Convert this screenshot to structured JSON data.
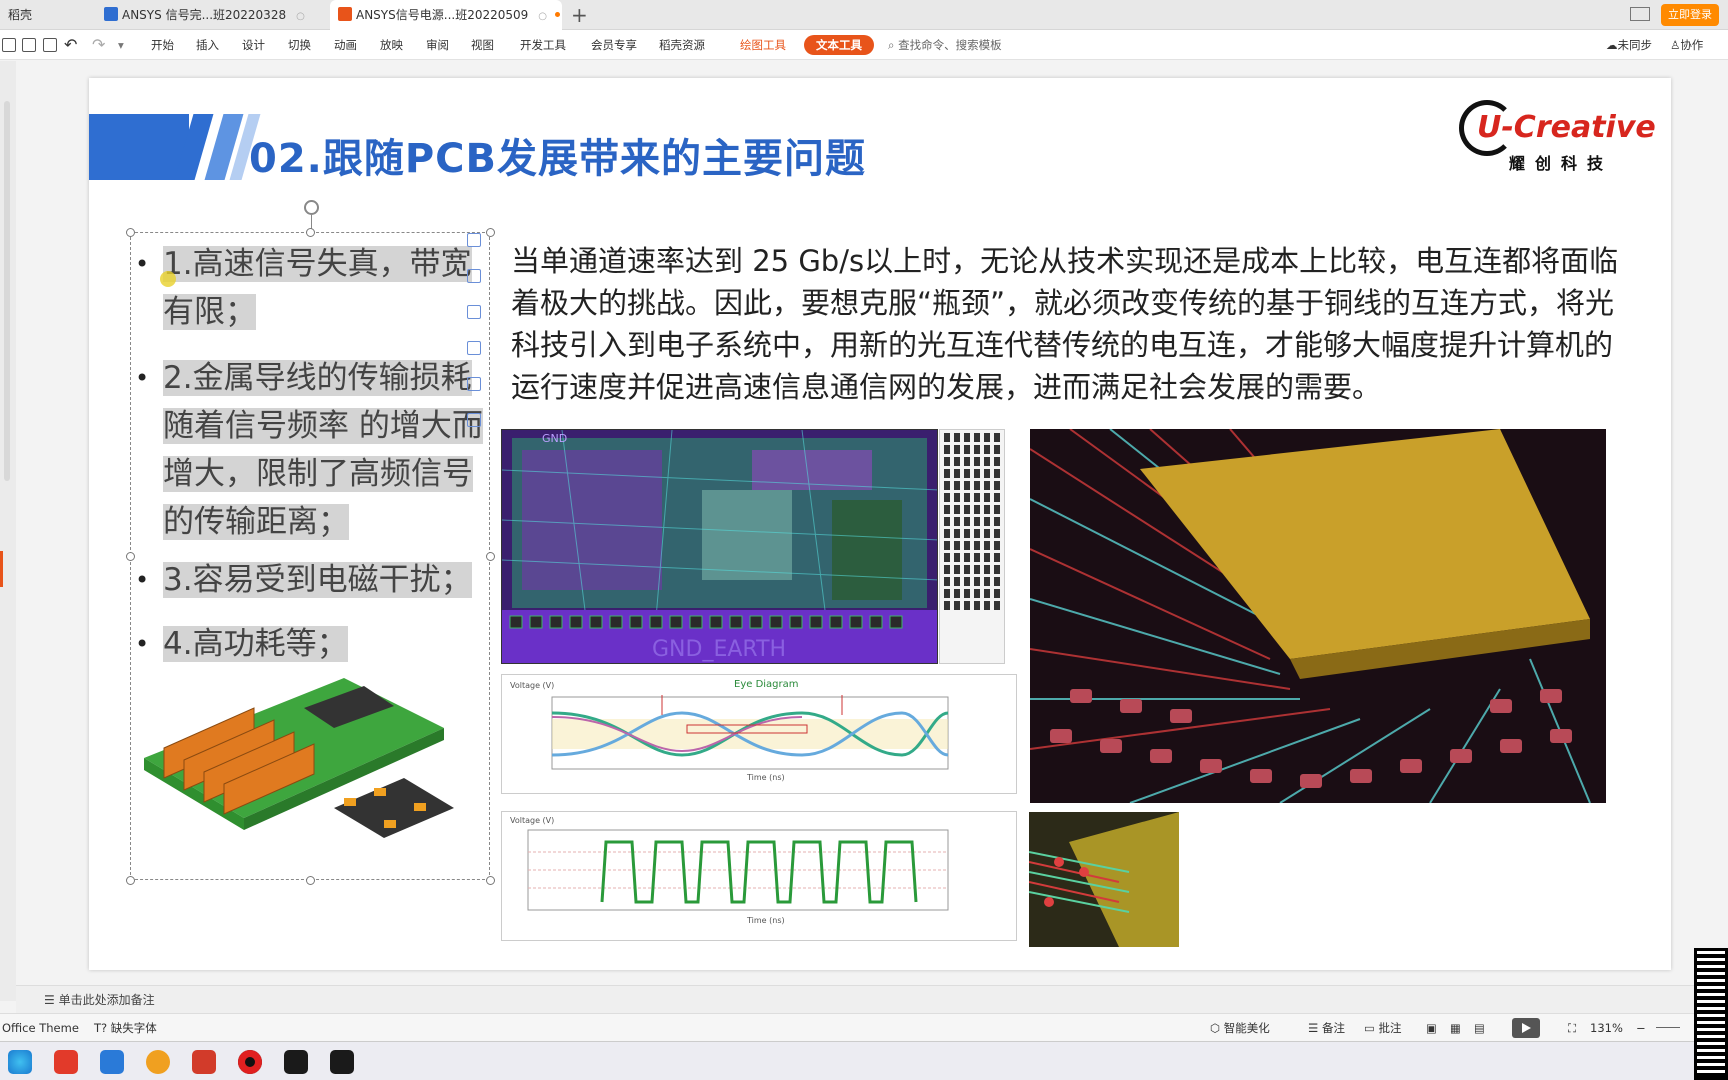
{
  "tabs": {
    "home": "稻壳",
    "doc1": "ANSYS 信号完...班20220328",
    "doc2": "ANSYS信号电源...班20220509",
    "new_tab": "+",
    "login": "立即登录"
  },
  "menu": {
    "items": [
      "开始",
      "插入",
      "设计",
      "切换",
      "动画",
      "放映",
      "审阅",
      "视图",
      "开发工具",
      "会员专享",
      "稻壳资源"
    ],
    "draw_tools": "绘图工具",
    "text_tools": "文本工具",
    "search": "查找命令、搜索模板",
    "unsynced": "未同步",
    "collab": "协作"
  },
  "slide": {
    "title": "02.跟随PCB发展带来的主要问题",
    "logo_en": "U-Creative",
    "logo_cn": "耀创科技",
    "bullets": [
      "1.高速信号失真，带宽有限；",
      "2.金属导线的传输损耗随着信号频率 的增大而增大，限制了高频信号的传输距离；",
      "3.容易受到电磁干扰；",
      "4.高功耗等；"
    ],
    "paragraph": "当单通道速率达到 25 Gb/s以上时，无论从技术实现还是成本上比较，电互连都将面临着极大的挑战。因此，要想克服“瓶颈”，就必须改变传统的基于铜线的互连方式，将光科技引入到电子系统中，用新的光互连代替传统的电互连，才能够大幅度提升计算机的运行速度并促进高速信息通信网的发展，进而满足社会发展的需要。",
    "pcb_labels": {
      "top": "GND",
      "bottom": "GND_EARTH"
    },
    "eye_title": "Eye Diagram",
    "eye_ylabel": "Voltage (V)",
    "eye_xlabel": "Time (ns)",
    "wave_ylabel": "Voltage (V)",
    "wave_xlabel": "Time (ns)"
  },
  "notes": {
    "placeholder": "单击此处添加备注"
  },
  "status": {
    "theme": "Office Theme",
    "missing_font": "缺失字体",
    "beautify": "智能美化",
    "notes": "备注",
    "comments": "批注",
    "zoom": "131%"
  },
  "colors": {
    "accent": "#e8541a",
    "title_blue": "#2a64c4",
    "band_blue": "#2f6ed1",
    "logo_red": "#d7261e"
  }
}
